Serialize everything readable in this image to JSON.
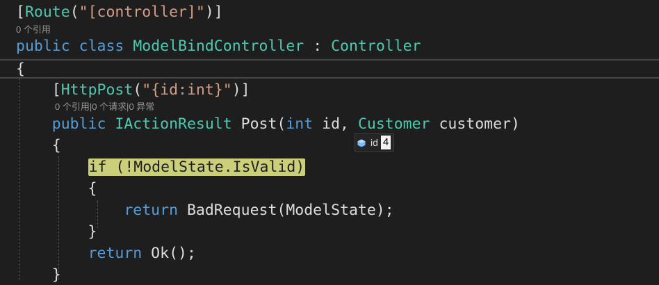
{
  "code": {
    "route_attr": {
      "open": "[",
      "name": "Route",
      "paren_open": "(",
      "string": "\"[controller]\"",
      "close": ")]"
    },
    "class_lens": "0 个引用",
    "class_decl": {
      "kw_public": "public",
      "kw_class": "class",
      "class_name": "ModelBindController",
      "colon": " : ",
      "base": "Controller"
    },
    "open_brace_class": "{",
    "post_attr": {
      "indent": "    ",
      "open": "[",
      "name": "HttpPost",
      "paren_open": "(",
      "string": "\"{id:int}\"",
      "close": ")]"
    },
    "method_lens": "0 个引用|0 个请求|0 异常",
    "method_decl": {
      "indent": "    ",
      "kw_public": "public",
      "return_type": "IActionResult",
      "method": " Post(",
      "kw_int": "int",
      "param1": " id, ",
      "param_type": "Customer",
      "param2": " customer)"
    },
    "open_brace_method": "    {",
    "if_line": {
      "indent": "        ",
      "text": "if (!ModelState.IsValid)"
    },
    "open_brace_if": "        {",
    "return_bad": {
      "indent": "            ",
      "kw_return": "return",
      "rest": " BadRequest(ModelState);"
    },
    "close_brace_if": "        }",
    "return_ok": {
      "indent": "        ",
      "kw_return": "return",
      "rest": " Ok();"
    },
    "close_brace_method": "    }"
  },
  "datatip": {
    "icon": "local-variable-icon",
    "name": "id",
    "value": "4"
  },
  "colors": {
    "background": "#1e1e1e",
    "keyword": "#569cd6",
    "type": "#4ec9b0",
    "string": "#d69d85",
    "highlight": "#cbcf7a"
  }
}
